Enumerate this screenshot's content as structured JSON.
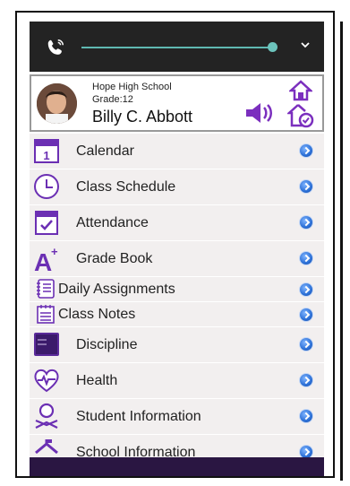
{
  "profile": {
    "school": "Hope High School",
    "grade": "Grade:12",
    "name": "Billy C. Abbott"
  },
  "menu": [
    {
      "label": "Calendar",
      "icon": "calendar-icon"
    },
    {
      "label": "Class Schedule",
      "icon": "clock-icon"
    },
    {
      "label": "Attendance",
      "icon": "attendance-icon"
    },
    {
      "label": "Grade Book",
      "icon": "grade-a-plus-icon"
    },
    {
      "label": "Daily Assignments",
      "icon": "notebook-icon"
    },
    {
      "label": "Class Notes",
      "icon": "notes-icon"
    },
    {
      "label": "Discipline",
      "icon": "chalkboard-icon"
    },
    {
      "label": "Health",
      "icon": "heart-pulse-icon"
    },
    {
      "label": "Student Information",
      "icon": "student-reading-icon"
    },
    {
      "label": "School Information",
      "icon": "school-icon"
    }
  ],
  "colors": {
    "accent_purple": "#6b2fb3",
    "call_bar": "#232323",
    "slider": "#5fb8b1",
    "bottom_bar": "#2a1642"
  }
}
